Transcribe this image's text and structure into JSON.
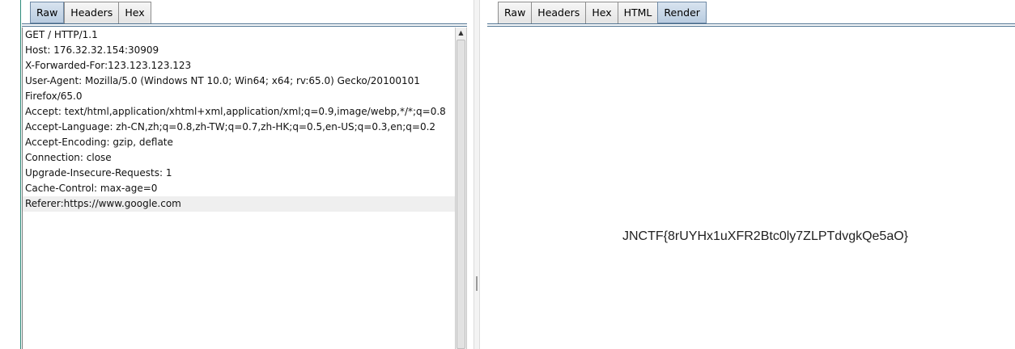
{
  "request_panel": {
    "tabs": [
      {
        "label": "Raw",
        "active": true
      },
      {
        "label": "Headers",
        "active": false
      },
      {
        "label": "Hex",
        "active": false
      }
    ],
    "lines": [
      "GET / HTTP/1.1",
      "Host: 176.32.32.154:30909",
      "X-Forwarded-For:123.123.123.123",
      "User-Agent: Mozilla/5.0 (Windows NT 10.0; Win64; x64; rv:65.0) Gecko/20100101",
      "Firefox/65.0",
      "Accept: text/html,application/xhtml+xml,application/xml;q=0.9,image/webp,*/*;q=0.8",
      "Accept-Language: zh-CN,zh;q=0.8,zh-TW;q=0.7,zh-HK;q=0.5,en-US;q=0.3,en;q=0.2",
      "Accept-Encoding: gzip, deflate",
      "Connection: close",
      "Upgrade-Insecure-Requests: 1",
      "Cache-Control: max-age=0",
      "Referer:https://www.google.com"
    ],
    "current_line_index": 11,
    "scroll_up_icon": "▲"
  },
  "response_panel": {
    "tabs": [
      {
        "label": "Raw",
        "active": false
      },
      {
        "label": "Headers",
        "active": false
      },
      {
        "label": "Hex",
        "active": false
      },
      {
        "label": "HTML",
        "active": false
      },
      {
        "label": "Render",
        "active": true
      }
    ],
    "render_text": "JNCTF{8rUYHx1uXFR2Btc0ly7ZLPTdvgkQe5aO}"
  },
  "colors": {
    "active_tab": "#c5d6e8",
    "tab_border": "#8e8e8e",
    "current_line": "#efefef",
    "left_strip_border": "#2e8b7a"
  }
}
